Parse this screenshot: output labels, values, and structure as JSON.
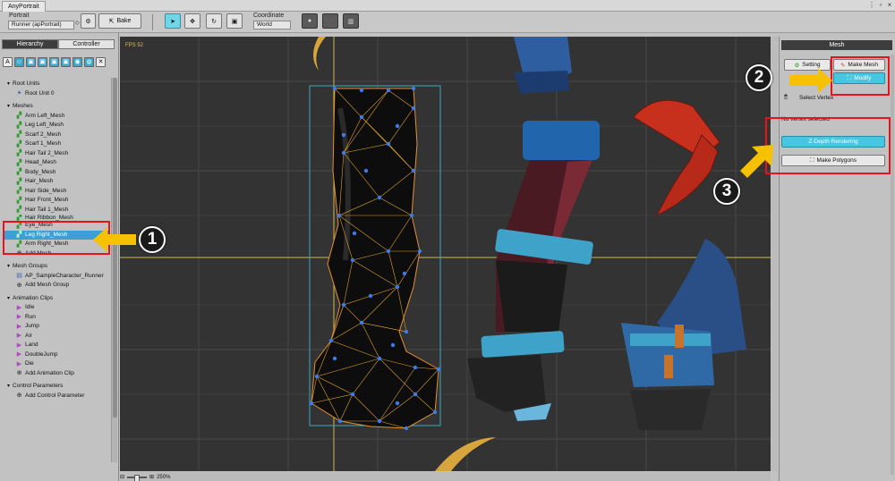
{
  "window": {
    "title": "AnyPortrait"
  },
  "toolbar": {
    "portrait_label": "Portrait",
    "portrait_value": "Runner (apPortrait)",
    "bake_label": "Bake",
    "coordinate_label": "Coordinate",
    "coordinate_value": "World"
  },
  "left_panel": {
    "tabs": [
      "Hierarchy",
      "Controller"
    ],
    "filter_icons": [
      "A",
      "☺",
      "▣",
      "▣",
      "▣",
      "▣",
      "◉",
      "◍",
      "✕"
    ],
    "sections": {
      "root_units": {
        "label": "Root Units",
        "items": [
          "Root Unit 0"
        ]
      },
      "meshes": {
        "label": "Meshes",
        "items": [
          "Arm Left_Mesh",
          "Leg Left_Mesh",
          "Scarf 2_Mesh",
          "Scarf 1_Mesh",
          "Hair Tail 2_Mesh",
          "Head_Mesh",
          "Body_Mesh",
          "Hair_Mesh",
          "Hair Side_Mesh",
          "Hair Front_Mesh",
          "Hair Tail 1_Mesh",
          "Hair Ribbon_Mesh",
          "Eye_Mesh",
          "Leg Right_Mesh",
          "Arm Right_Mesh"
        ],
        "add": "Add Mesh",
        "selected": "Leg Right_Mesh"
      },
      "mesh_groups": {
        "label": "Mesh Groups",
        "items": [
          "AP_SampleCharacter_Runner"
        ],
        "add": "Add Mesh Group"
      },
      "animation_clips": {
        "label": "Animation Clips",
        "items": [
          "Idle",
          "Run",
          "Jump",
          "Air",
          "Land",
          "DoubleJump",
          "Die"
        ],
        "add": "Add Animation Clip"
      },
      "control_parameters": {
        "label": "Control Parameters",
        "add": "Add Control Parameter"
      }
    }
  },
  "canvas": {
    "fps": "FPS 52",
    "zoom": "250%"
  },
  "right_panel": {
    "title": "Mesh",
    "setting_label": "Setting",
    "make_mesh_label": "Make Mesh",
    "modify_label": "Modify",
    "select_vertex_label": "Select Vertex",
    "status": "No vertex selected",
    "zdepth_label": "Z-Depth Rendering",
    "make_polygons_label": "Make Polygons"
  },
  "annotations": {
    "step1": "1",
    "step2": "2",
    "step3": "3"
  },
  "colors": {
    "highlight": "#e8141a",
    "arrow": "#f6c100",
    "accent": "#46c6e0",
    "selected_row": "#3d9fd6"
  }
}
